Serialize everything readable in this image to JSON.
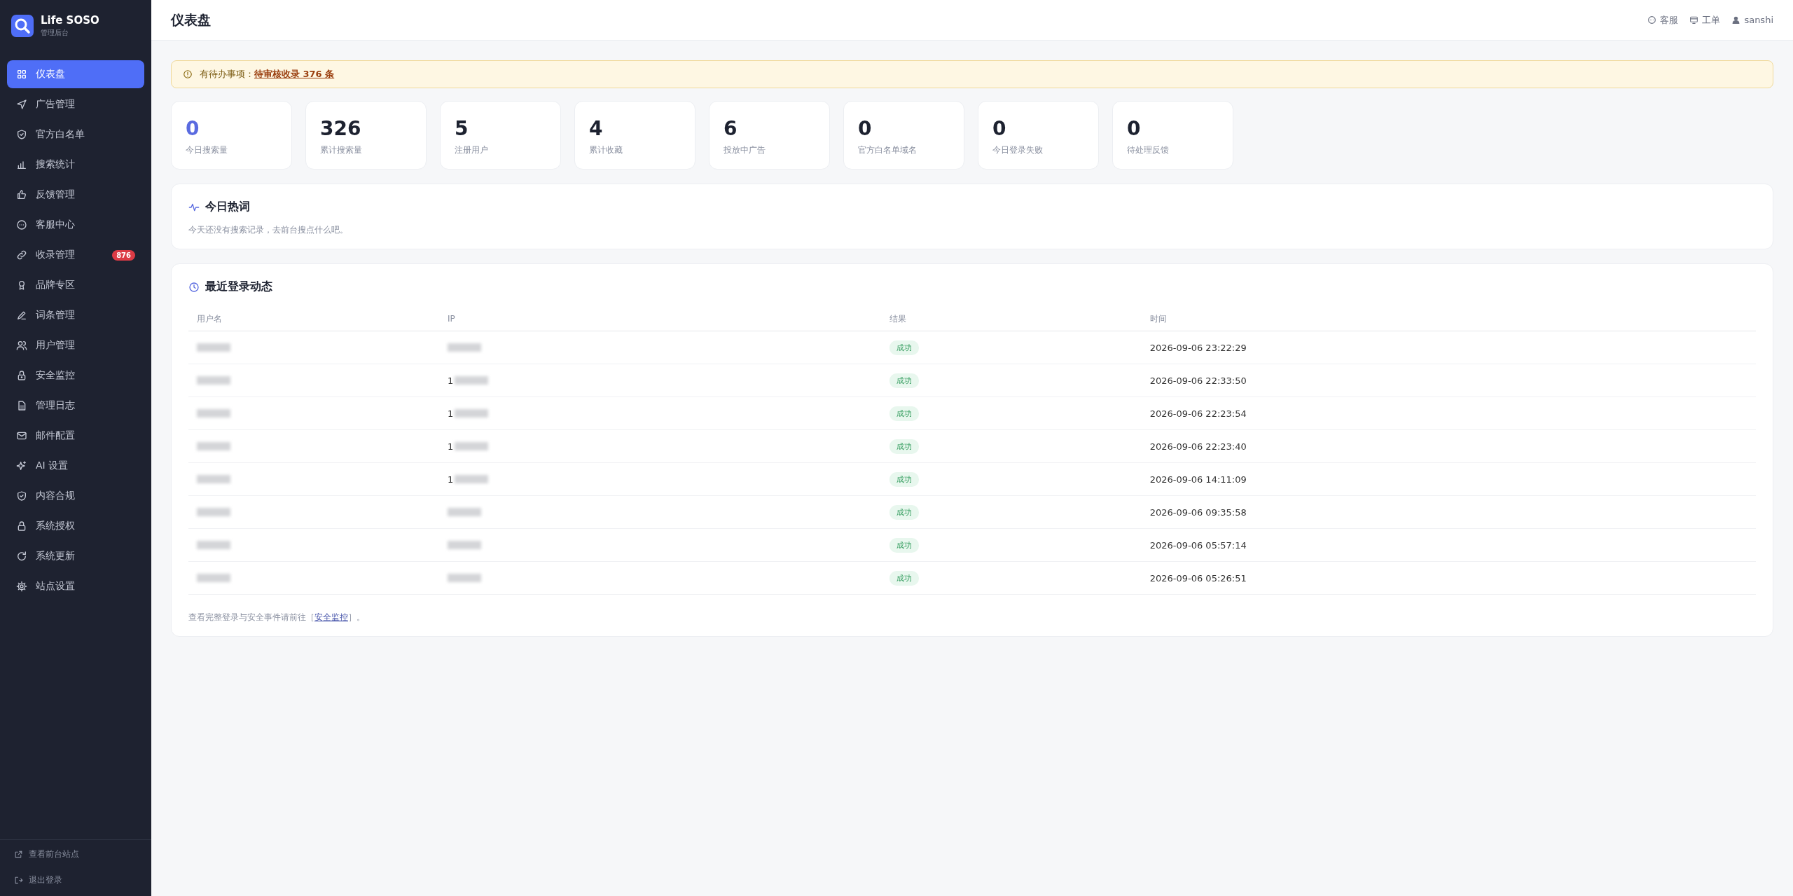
{
  "brand": {
    "name": "Life SOSO",
    "subtitle": "管理后台"
  },
  "sidebar": {
    "items": [
      {
        "label": "仪表盘",
        "kind": "grid",
        "selected": true
      },
      {
        "label": "广告管理",
        "kind": "send",
        "selected": false
      },
      {
        "label": "官方白名单",
        "kind": "shield",
        "selected": false
      },
      {
        "label": "搜索统计",
        "kind": "bars",
        "selected": false
      },
      {
        "label": "反馈管理",
        "kind": "thumb",
        "selected": false
      },
      {
        "label": "客服中心",
        "kind": "chat",
        "selected": false
      },
      {
        "label": "收录管理",
        "kind": "link",
        "selected": false,
        "badge": "876"
      },
      {
        "label": "品牌专区",
        "kind": "award",
        "selected": false
      },
      {
        "label": "词条管理",
        "kind": "pen",
        "selected": false
      },
      {
        "label": "用户管理",
        "kind": "users",
        "selected": false
      },
      {
        "label": "安全监控",
        "kind": "lock",
        "selected": false
      },
      {
        "label": "管理日志",
        "kind": "doc",
        "selected": false
      },
      {
        "label": "邮件配置",
        "kind": "mail",
        "selected": false
      },
      {
        "label": "AI 设置",
        "kind": "sparkle",
        "selected": false
      },
      {
        "label": "内容合规",
        "kind": "shield",
        "selected": false
      },
      {
        "label": "系统授权",
        "kind": "lock2",
        "selected": false
      },
      {
        "label": "系统更新",
        "kind": "refresh",
        "selected": false
      },
      {
        "label": "站点设置",
        "kind": "gear",
        "selected": false
      }
    ],
    "footer": [
      {
        "label": "查看前台站点",
        "kind": "external"
      },
      {
        "label": "退出登录",
        "kind": "logout"
      }
    ]
  },
  "header": {
    "title": "仪表盘",
    "links": [
      {
        "label": "客服",
        "kind": "chat"
      },
      {
        "label": "工单",
        "kind": "monitor"
      },
      {
        "label": "sanshi",
        "kind": "user"
      }
    ]
  },
  "alert": {
    "label": "有待办事项：",
    "link": "待审核收录 376 条"
  },
  "stats": [
    {
      "value": "0",
      "label": "今日搜索量",
      "highlight": true
    },
    {
      "value": "326",
      "label": "累计搜索量",
      "highlight": false
    },
    {
      "value": "5",
      "label": "注册用户",
      "highlight": false
    },
    {
      "value": "4",
      "label": "累计收藏",
      "highlight": false
    },
    {
      "value": "6",
      "label": "投放中广告",
      "highlight": false
    },
    {
      "value": "0",
      "label": "官方白名单域名",
      "highlight": false
    },
    {
      "value": "0",
      "label": "今日登录失败",
      "highlight": false
    },
    {
      "value": "0",
      "label": "待处理反馈",
      "highlight": false
    }
  ],
  "hot_words": {
    "title": "今日热词",
    "empty_text": "今天还没有搜索记录，去前台搜点什么吧。"
  },
  "logins": {
    "title": "最近登录动态",
    "columns": [
      "用户名",
      "IP",
      "结果",
      "时间"
    ],
    "rows": [
      {
        "ip_prefix": "",
        "result": "成功",
        "time": "2026-09-06 23:22:29"
      },
      {
        "ip_prefix": "1",
        "result": "成功",
        "time": "2026-09-06 22:33:50"
      },
      {
        "ip_prefix": "1",
        "result": "成功",
        "time": "2026-09-06 22:23:54"
      },
      {
        "ip_prefix": "1",
        "result": "成功",
        "time": "2026-09-06 22:23:40"
      },
      {
        "ip_prefix": "1",
        "result": "成功",
        "time": "2026-09-06 14:11:09"
      },
      {
        "ip_prefix": "",
        "result": "成功",
        "time": "2026-09-06 09:35:58"
      },
      {
        "ip_prefix": "",
        "result": "成功",
        "time": "2026-09-06 05:57:14"
      },
      {
        "ip_prefix": "",
        "result": "成功",
        "time": "2026-09-06 05:26:51"
      }
    ],
    "note": {
      "before": "查看完整登录与安全事件请前往［",
      "link": "安全监控",
      "after": "］。"
    }
  }
}
